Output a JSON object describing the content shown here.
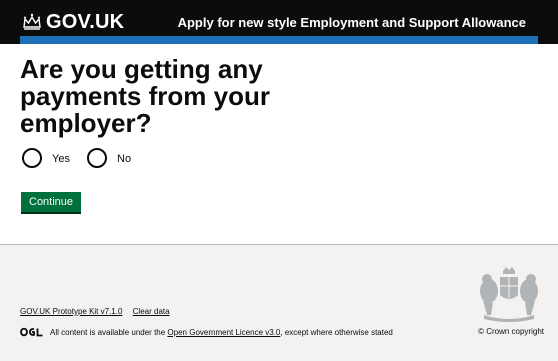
{
  "header": {
    "logo_text": "GOV.UK",
    "service_name": "Apply for new style Employment and Support Allowance"
  },
  "question": {
    "heading": "Are you getting any payments from your employer?",
    "options": [
      {
        "label": "Yes",
        "selected": false
      },
      {
        "label": "No",
        "selected": false
      }
    ],
    "continue_label": "Continue"
  },
  "footer": {
    "links": [
      "GOV.UK Prototype Kit v7.1.0",
      "Clear data"
    ],
    "licence_prefix": "All content is available under the ",
    "licence_link": "Open Government Licence v3.0",
    "licence_suffix": ", except where otherwise stated",
    "copyright": "© Crown copyright"
  },
  "colors": {
    "header_bg": "#0b0c0c",
    "accent_blue": "#1d70b8",
    "button_green": "#00703c",
    "footer_bg": "#f3f2f1"
  }
}
